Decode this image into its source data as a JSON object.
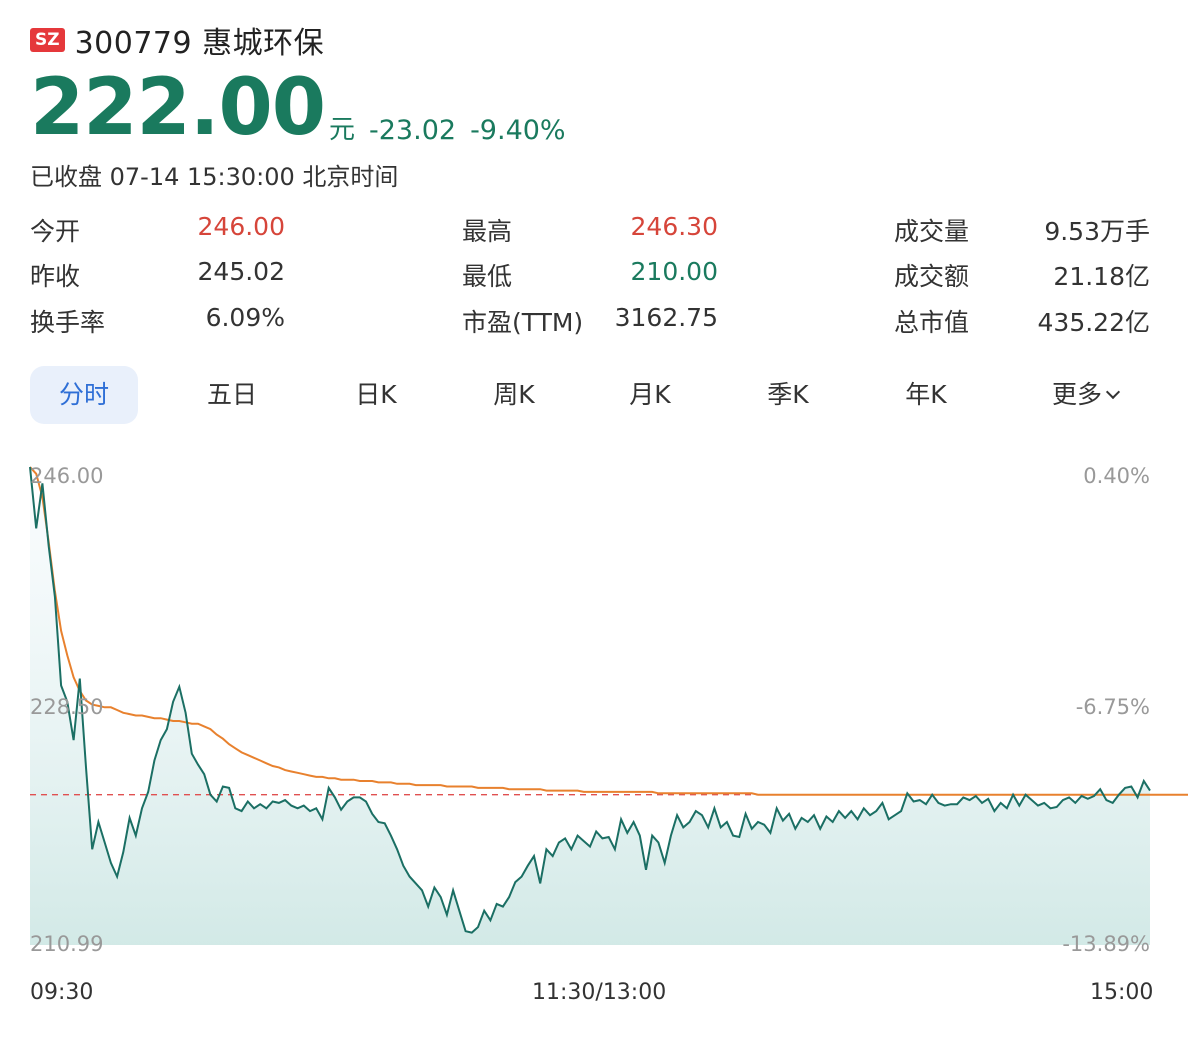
{
  "header": {
    "exchange": "SZ",
    "name": "300779 惠城环保"
  },
  "quote": {
    "price": "222.00",
    "unit": "元",
    "change": "-23.02",
    "change_pct": "-9.40%",
    "status": "已收盘 07-14 15:30:00 北京时间"
  },
  "stats": [
    {
      "label": "今开",
      "value": "246.00",
      "tone": "red"
    },
    {
      "label": "最高",
      "value": "246.30",
      "tone": "red"
    },
    {
      "label": "成交量",
      "value": "9.53万手",
      "tone": "neutral"
    },
    {
      "label": "昨收",
      "value": "245.02",
      "tone": "neutral"
    },
    {
      "label": "最低",
      "value": "210.00",
      "tone": "green"
    },
    {
      "label": "成交额",
      "value": "21.18亿",
      "tone": "neutral"
    },
    {
      "label": "换手率",
      "value": "6.09%",
      "tone": "neutral"
    },
    {
      "label": "市盈(TTM)",
      "value": "3162.75",
      "tone": "neutral"
    },
    {
      "label": "总市值",
      "value": "435.22亿",
      "tone": "neutral"
    }
  ],
  "tabs": [
    "分时",
    "五日",
    "日K",
    "周K",
    "月K",
    "季K",
    "年K",
    "更多"
  ],
  "active_tab": "分时",
  "colors": {
    "price_line": "#1b6f64",
    "avg_line": "#e8812e",
    "prev_close_line": "#e05050",
    "down": "#1a7a5e",
    "up": "#d6453a",
    "active_tab": "#2f6fd6"
  },
  "chart_data": {
    "type": "line",
    "title": "",
    "y_left_labels": [
      "246.00",
      "228.50",
      "210.99"
    ],
    "y_right_labels": [
      "0.40%",
      "-6.75%",
      "-13.89%"
    ],
    "x_labels": [
      "09:30",
      "11:30/13:00",
      "15:00"
    ],
    "ylim": [
      210.99,
      246.0
    ],
    "prev_close": 222.0,
    "series": [
      {
        "values": [
          246.0,
          241.5,
          244.8,
          240.2,
          236.5,
          230.0,
          228.8,
          226.0,
          230.5,
          224.0,
          218.0,
          220.0,
          218.5,
          217.0,
          216.0,
          217.8,
          220.3,
          219.0,
          221.0,
          222.2,
          224.5,
          226.0,
          226.8,
          228.8,
          229.9,
          228.0,
          225.0,
          224.2,
          223.5,
          222.0,
          221.5,
          222.6,
          222.5,
          221.0,
          220.8,
          221.5,
          221.0,
          221.3,
          221.0,
          221.5,
          221.4,
          221.6,
          221.2,
          221.0,
          221.2,
          220.8,
          221.0,
          220.2,
          222.5,
          221.8,
          220.9,
          221.5,
          221.8,
          221.8,
          221.5,
          220.6,
          220.0,
          219.9,
          219.0,
          218.0,
          216.8,
          216.0,
          215.5,
          215.0,
          213.8,
          215.2,
          214.5,
          213.2,
          215.0,
          213.5,
          212.0,
          211.9,
          212.3,
          213.5,
          212.8,
          214.0,
          213.8,
          214.5,
          215.6,
          216.0,
          216.8,
          217.5,
          215.5,
          218.0,
          217.5,
          218.5,
          218.8,
          218.0,
          219.0,
          218.6,
          218.2,
          219.3,
          218.8,
          218.9,
          218.0,
          220.2,
          219.2,
          220.0,
          219.0,
          216.5,
          219.0,
          218.5,
          217.0,
          219.0,
          220.5,
          219.6,
          220.0,
          220.8,
          220.5,
          219.6,
          221.0,
          219.6,
          220.0,
          219.0,
          218.9,
          220.6,
          219.5,
          220.0,
          219.8,
          219.2,
          221.0,
          220.1,
          220.6,
          219.5,
          220.3,
          220.0,
          220.5,
          219.5,
          220.4,
          220.0,
          220.8,
          220.3,
          220.8,
          220.2,
          221.0,
          220.5,
          220.8,
          221.4,
          220.2,
          220.5,
          220.8,
          222.1,
          221.5,
          221.6,
          221.3,
          222.0,
          221.4,
          221.2,
          221.3,
          221.3,
          221.8,
          221.6,
          221.9,
          221.4,
          221.7,
          220.8,
          221.4,
          221.0,
          222.0,
          221.2,
          222.0,
          221.6,
          221.2,
          221.4,
          221.0,
          221.1,
          221.6,
          221.8,
          221.4,
          221.9,
          221.7,
          221.9,
          222.4,
          221.6,
          221.4,
          222.0,
          222.5,
          222.6,
          221.8,
          223.0,
          222.3
        ],
        "avg_values": [
          246.0,
          245.5,
          243.8,
          240.5,
          236.9,
          234.0,
          232.2,
          230.6,
          229.6,
          228.9,
          228.6,
          228.5,
          228.4,
          228.4,
          228.2,
          228.0,
          227.9,
          227.8,
          227.8,
          227.7,
          227.6,
          227.6,
          227.5,
          227.4,
          227.4,
          227.3,
          227.2,
          227.2,
          227.0,
          226.8,
          226.4,
          226.1,
          225.7,
          225.4,
          225.1,
          224.9,
          224.7,
          224.5,
          224.3,
          224.1,
          224.0,
          223.8,
          223.7,
          223.6,
          223.5,
          223.4,
          223.3,
          223.3,
          223.2,
          223.2,
          223.1,
          223.1,
          223.1,
          223.0,
          223.0,
          223.0,
          222.9,
          222.9,
          222.9,
          222.8,
          222.8,
          222.8,
          222.7,
          222.7,
          222.7,
          222.7,
          222.7,
          222.6,
          222.6,
          222.6,
          222.6,
          222.6,
          222.5,
          222.5,
          222.5,
          222.5,
          222.5,
          222.4,
          222.4,
          222.4,
          222.4,
          222.4,
          222.4,
          222.3,
          222.3,
          222.3,
          222.3,
          222.3,
          222.3,
          222.2,
          222.2,
          222.2,
          222.2,
          222.2,
          222.2,
          222.2,
          222.2,
          222.2,
          222.2,
          222.2,
          222.2,
          222.1,
          222.1,
          222.1,
          222.1,
          222.1,
          222.1,
          222.1,
          222.1,
          222.1,
          222.1,
          222.1,
          222.1,
          222.1,
          222.1,
          222.1,
          222.1,
          222.0,
          222.0,
          222.0,
          222.0,
          222.0,
          222.0,
          222.0,
          222.0,
          222.0,
          222.0,
          222.0,
          222.0,
          222.0,
          222.0,
          222.0,
          222.0,
          222.0,
          222.0,
          222.0,
          222.0,
          222.0,
          222.0,
          222.0,
          222.0,
          222.0,
          222.0,
          222.0,
          222.0,
          222.0,
          222.0,
          222.0,
          222.0,
          222.0,
          222.0,
          222.0,
          222.0,
          222.0,
          222.0,
          222.0,
          222.0,
          222.0,
          222.0,
          222.0,
          222.0,
          222.0,
          222.0,
          222.0,
          222.0,
          222.0,
          222.0,
          222.0,
          222.0,
          222.0,
          222.0,
          222.0,
          222.0,
          222.0,
          222.0,
          222.0,
          222.0,
          222.0,
          222.0,
          222.0,
          222.0,
          222.0,
          222.0,
          222.0,
          222.0,
          222.0,
          222.0,
          222.0,
          222.0
        ]
      }
    ]
  }
}
